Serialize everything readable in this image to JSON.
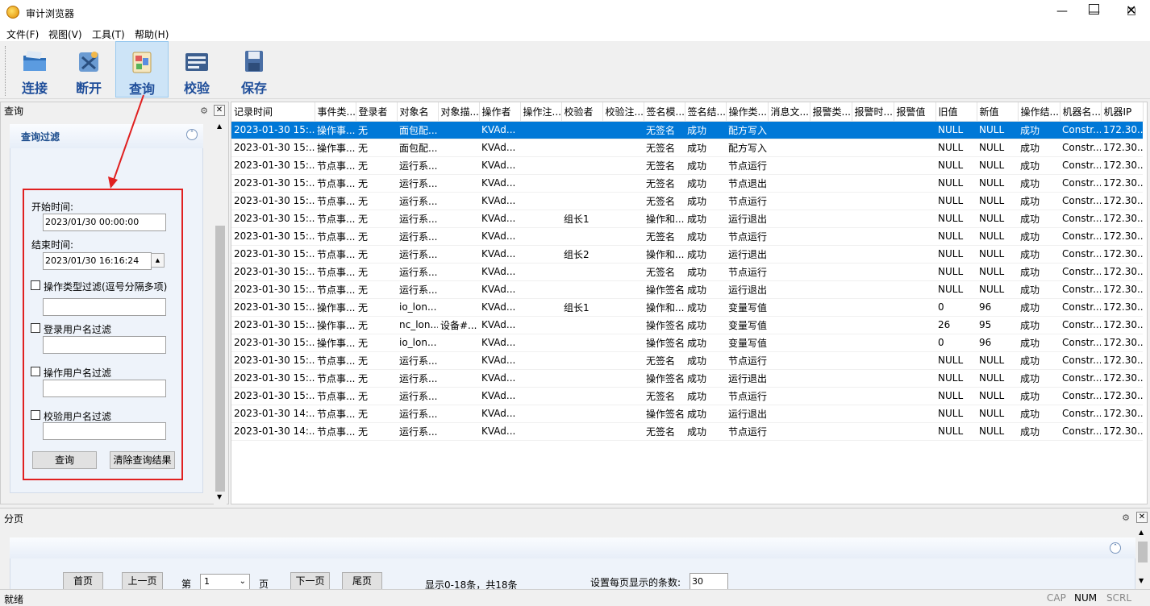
{
  "window": {
    "title": "审计浏览器"
  },
  "menu": [
    "文件(F)",
    "视图(V)",
    "工具(T)",
    "帮助(H)"
  ],
  "toolbar": {
    "connect": "连接",
    "disconnect": "断开",
    "query": "查询",
    "verify": "校验",
    "save": "保存"
  },
  "left_panel": {
    "title": "查询",
    "filter_title": "查询过滤",
    "start_label": "开始时间:",
    "start_value": "2023/01/30 00:00:00",
    "end_label": "结束时间:",
    "end_value": "2023/01/30 16:16:24",
    "op_type_filter": "操作类型过滤(逗号分隔多项)",
    "login_user_filter": "登录用户名过滤",
    "op_user_filter": "操作用户名过滤",
    "verify_user_filter": "校验用户名过滤",
    "query_button": "查询",
    "clear_button": "清除查询结果"
  },
  "table": {
    "columns": [
      "记录时间",
      "事件类...",
      "登录者",
      "对象名",
      "对象描...",
      "操作者",
      "操作注...",
      "校验者",
      "校验注...",
      "签名模...",
      "签名结...",
      "操作类...",
      "消息文...",
      "报警类...",
      "报警时...",
      "报警值",
      "旧值",
      "新值",
      "操作结...",
      "机器名...",
      "机器IP"
    ],
    "rows": [
      [
        "2023-01-30 15:...",
        "操作事...",
        "无",
        "面包配...",
        "",
        "KVAd...",
        "",
        "",
        "",
        "无签名",
        "成功",
        "配方写入",
        "",
        "",
        "",
        "",
        "NULL",
        "NULL",
        "成功",
        "Constr...",
        "172.30..."
      ],
      [
        "2023-01-30 15:...",
        "操作事...",
        "无",
        "面包配...",
        "",
        "KVAd...",
        "",
        "",
        "",
        "无签名",
        "成功",
        "配方写入",
        "",
        "",
        "",
        "",
        "NULL",
        "NULL",
        "成功",
        "Constr...",
        "172.30..."
      ],
      [
        "2023-01-30 15:...",
        "节点事...",
        "无",
        "运行系...",
        "",
        "KVAd...",
        "",
        "",
        "",
        "无签名",
        "成功",
        "节点运行",
        "",
        "",
        "",
        "",
        "NULL",
        "NULL",
        "成功",
        "Constr...",
        "172.30..."
      ],
      [
        "2023-01-30 15:...",
        "节点事...",
        "无",
        "运行系...",
        "",
        "KVAd...",
        "",
        "",
        "",
        "无签名",
        "成功",
        "节点退出",
        "",
        "",
        "",
        "",
        "NULL",
        "NULL",
        "成功",
        "Constr...",
        "172.30..."
      ],
      [
        "2023-01-30 15:...",
        "节点事...",
        "无",
        "运行系...",
        "",
        "KVAd...",
        "",
        "",
        "",
        "无签名",
        "成功",
        "节点运行",
        "",
        "",
        "",
        "",
        "NULL",
        "NULL",
        "成功",
        "Constr...",
        "172.30..."
      ],
      [
        "2023-01-30 15:...",
        "节点事...",
        "无",
        "运行系...",
        "",
        "KVAd...",
        "",
        "组长1",
        "",
        "操作和...",
        "成功",
        "运行退出",
        "",
        "",
        "",
        "",
        "NULL",
        "NULL",
        "成功",
        "Constr...",
        "172.30..."
      ],
      [
        "2023-01-30 15:...",
        "节点事...",
        "无",
        "运行系...",
        "",
        "KVAd...",
        "",
        "",
        "",
        "无签名",
        "成功",
        "节点运行",
        "",
        "",
        "",
        "",
        "NULL",
        "NULL",
        "成功",
        "Constr...",
        "172.30..."
      ],
      [
        "2023-01-30 15:...",
        "节点事...",
        "无",
        "运行系...",
        "",
        "KVAd...",
        "",
        "组长2",
        "",
        "操作和...",
        "成功",
        "运行退出",
        "",
        "",
        "",
        "",
        "NULL",
        "NULL",
        "成功",
        "Constr...",
        "172.30..."
      ],
      [
        "2023-01-30 15:...",
        "节点事...",
        "无",
        "运行系...",
        "",
        "KVAd...",
        "",
        "",
        "",
        "无签名",
        "成功",
        "节点运行",
        "",
        "",
        "",
        "",
        "NULL",
        "NULL",
        "成功",
        "Constr...",
        "172.30..."
      ],
      [
        "2023-01-30 15:...",
        "节点事...",
        "无",
        "运行系...",
        "",
        "KVAd...",
        "",
        "",
        "",
        "操作签名",
        "成功",
        "运行退出",
        "",
        "",
        "",
        "",
        "NULL",
        "NULL",
        "成功",
        "Constr...",
        "172.30..."
      ],
      [
        "2023-01-30 15:...",
        "操作事...",
        "无",
        "io_lon...",
        "",
        "KVAd...",
        "",
        "组长1",
        "",
        "操作和...",
        "成功",
        "变量写值",
        "",
        "",
        "",
        "",
        "0",
        "96",
        "成功",
        "Constr...",
        "172.30..."
      ],
      [
        "2023-01-30 15:...",
        "操作事...",
        "无",
        "nc_lon...",
        "设备#...",
        "KVAd...",
        "",
        "",
        "",
        "操作签名",
        "成功",
        "变量写值",
        "",
        "",
        "",
        "",
        "26",
        "95",
        "成功",
        "Constr...",
        "172.30..."
      ],
      [
        "2023-01-30 15:...",
        "操作事...",
        "无",
        "io_lon...",
        "",
        "KVAd...",
        "",
        "",
        "",
        "操作签名",
        "成功",
        "变量写值",
        "",
        "",
        "",
        "",
        "0",
        "96",
        "成功",
        "Constr...",
        "172.30..."
      ],
      [
        "2023-01-30 15:...",
        "节点事...",
        "无",
        "运行系...",
        "",
        "KVAd...",
        "",
        "",
        "",
        "无签名",
        "成功",
        "节点运行",
        "",
        "",
        "",
        "",
        "NULL",
        "NULL",
        "成功",
        "Constr...",
        "172.30..."
      ],
      [
        "2023-01-30 15:...",
        "节点事...",
        "无",
        "运行系...",
        "",
        "KVAd...",
        "",
        "",
        "",
        "操作签名",
        "成功",
        "运行退出",
        "",
        "",
        "",
        "",
        "NULL",
        "NULL",
        "成功",
        "Constr...",
        "172.30..."
      ],
      [
        "2023-01-30 15:...",
        "节点事...",
        "无",
        "运行系...",
        "",
        "KVAd...",
        "",
        "",
        "",
        "无签名",
        "成功",
        "节点运行",
        "",
        "",
        "",
        "",
        "NULL",
        "NULL",
        "成功",
        "Constr...",
        "172.30..."
      ],
      [
        "2023-01-30 14:...",
        "节点事...",
        "无",
        "运行系...",
        "",
        "KVAd...",
        "",
        "",
        "",
        "操作签名",
        "成功",
        "运行退出",
        "",
        "",
        "",
        "",
        "NULL",
        "NULL",
        "成功",
        "Constr...",
        "172.30..."
      ],
      [
        "2023-01-30 14:...",
        "节点事...",
        "无",
        "运行系...",
        "",
        "KVAd...",
        "",
        "",
        "",
        "无签名",
        "成功",
        "节点运行",
        "",
        "",
        "",
        "",
        "NULL",
        "NULL",
        "成功",
        "Constr...",
        "172.30..."
      ]
    ]
  },
  "pager": {
    "title": "分页",
    "first": "首页",
    "prev": "上一页",
    "page_prefix": "第",
    "page_value": "1",
    "page_suffix": "页",
    "next": "下一页",
    "last": "尾页",
    "info": "显示0-18条，共18条",
    "per_page_label": "设置每页显示的条数:",
    "per_page_value": "30"
  },
  "status": {
    "text": "就绪",
    "cap": "CAP",
    "num": "NUM",
    "scrl": "SCRL"
  },
  "colors": {
    "selection": "#0078d7",
    "annotation_red": "#e02020",
    "toolbar_label": "#1f4e9a"
  }
}
